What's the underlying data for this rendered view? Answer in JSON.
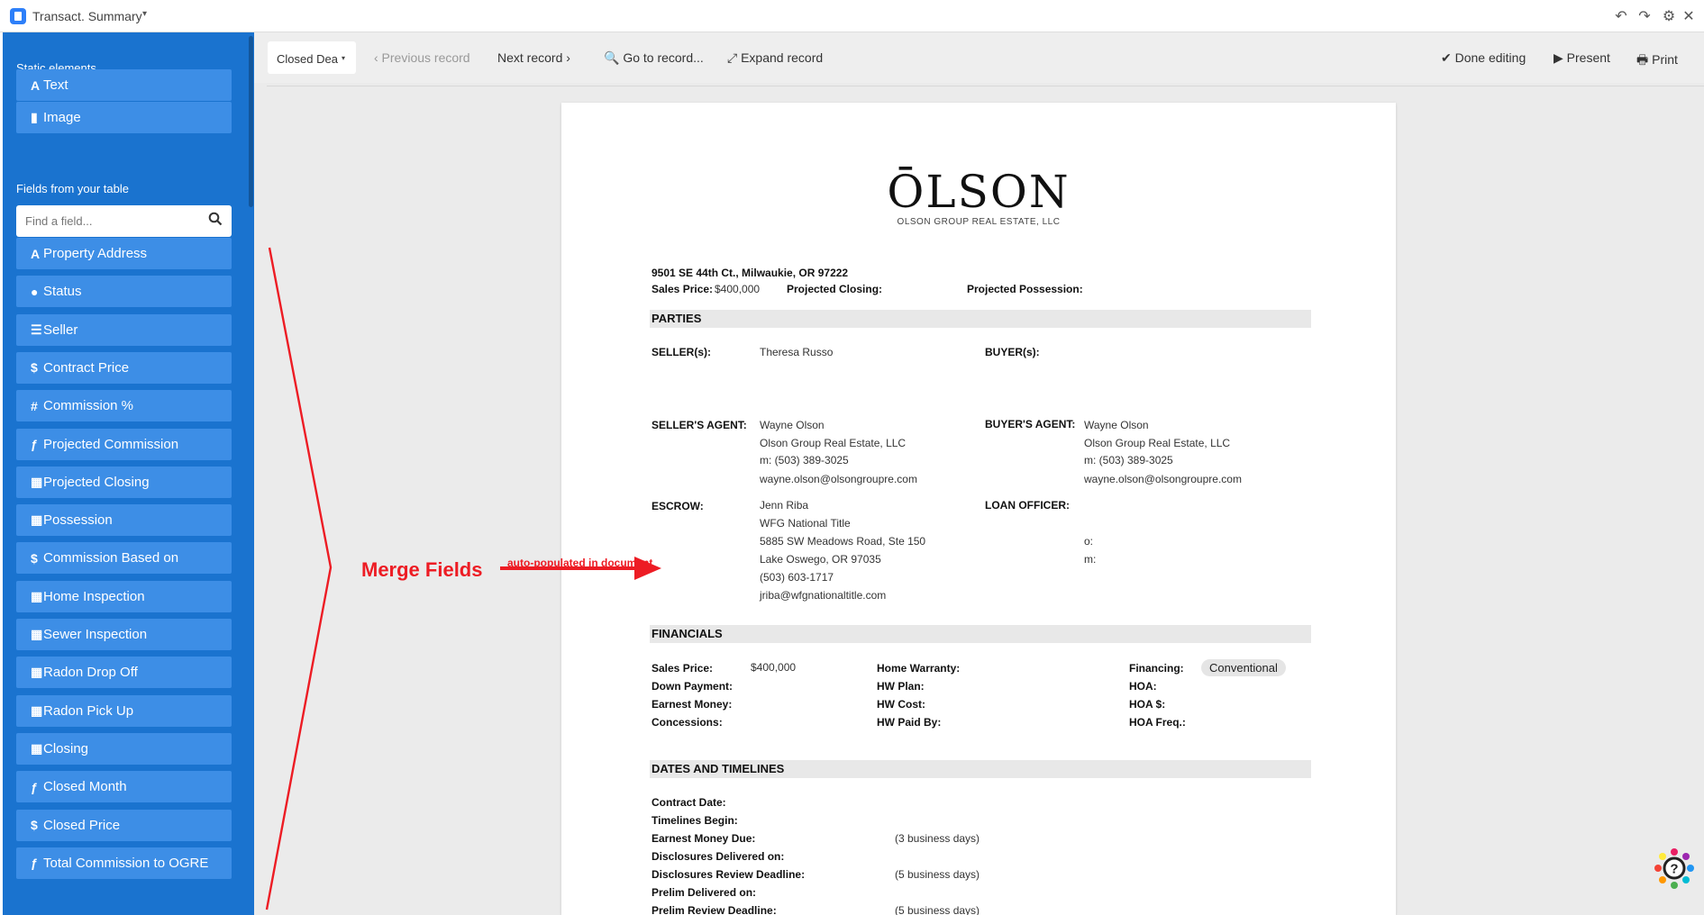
{
  "window": {
    "title": "Transact. Summary",
    "caret": "▾",
    "controls": {
      "undo": "↶",
      "redo": "↷",
      "settings": "⚙",
      "close": "✕"
    }
  },
  "sidebar": {
    "static_heading": "Static elements",
    "static_items": [
      {
        "icon": "A",
        "label": "Text"
      },
      {
        "icon": "▮",
        "label": "Image"
      }
    ],
    "fields_heading": "Fields from your table",
    "search_placeholder": "Find a field...",
    "fields": [
      {
        "icon": "A",
        "label": "Property Address"
      },
      {
        "icon": "●",
        "label": "Status"
      },
      {
        "icon": "☰",
        "label": "Seller"
      },
      {
        "icon": "$",
        "label": "Contract Price"
      },
      {
        "icon": "#",
        "label": "Commission %"
      },
      {
        "icon": "ƒ",
        "label": "Projected Commission"
      },
      {
        "icon": "▦",
        "label": "Projected Closing"
      },
      {
        "icon": "▦",
        "label": "Possession"
      },
      {
        "icon": "$",
        "label": "Commission Based on"
      },
      {
        "icon": "▦",
        "label": "Home Inspection"
      },
      {
        "icon": "▦",
        "label": "Sewer Inspection"
      },
      {
        "icon": "▦",
        "label": "Radon Drop Off"
      },
      {
        "icon": "▦",
        "label": "Radon Pick Up"
      },
      {
        "icon": "▦",
        "label": "Closing"
      },
      {
        "icon": "ƒ",
        "label": "Closed Month"
      },
      {
        "icon": "$",
        "label": "Closed Price"
      },
      {
        "icon": "ƒ",
        "label": "Total Commission to OGRE"
      }
    ]
  },
  "toolbar": {
    "view": "Closed Dea",
    "view_caret": "▾",
    "previous": "‹  Previous record",
    "next": "Next record  ›",
    "goto": "🔍 Go to record...",
    "expand": "⤢ Expand record",
    "done": "✔ Done editing",
    "present": "▶ Present",
    "print": "🖶 Print"
  },
  "document": {
    "logo": "ŌLSON",
    "logo_sub": "OLSON GROUP REAL ESTATE, LLC",
    "address": "9501 SE 44th Ct., Milwaukie, OR 97222",
    "sales_price_label": "Sales Price:",
    "sales_price": "$400,000",
    "projected_closing_label": "Projected Closing:",
    "projected_possession_label": "Projected Possession:",
    "parties_title": "PARTIES",
    "sellers_label": "SELLER(s):",
    "seller_name": "Theresa Russo",
    "buyers_label": "BUYER(s):",
    "sellers_agent_label": "SELLER'S AGENT:",
    "buyers_agent_label": "BUYER'S AGENT:",
    "agent": {
      "name": "Wayne Olson",
      "company": "Olson Group Real Estate, LLC",
      "phone": "m:  (503) 389-3025",
      "email": "wayne.olson@olsongroupre.com"
    },
    "escrow_label": "ESCROW:",
    "escrow": {
      "name": "Jenn Riba",
      "company": "WFG National Title",
      "street": "5885 SW Meadows Road, Ste 150",
      "city": "Lake Oswego, OR 97035",
      "phone": "(503) 603-1717",
      "email": "jriba@wfgnationaltitle.com"
    },
    "loan_officer_label": "LOAN OFFICER:",
    "lo_o": "o:",
    "lo_m": "m:",
    "financials_title": "FINANCIALS",
    "fin_col1": [
      "Sales Price:",
      "Down Payment:",
      "Earnest Money:",
      "Concessions:"
    ],
    "fin_sales_price": "$400,000",
    "fin_col2": [
      "Home Warranty:",
      "HW Plan:",
      "HW Cost:",
      "HW Paid By:"
    ],
    "fin_col3": [
      "Financing:",
      "HOA:",
      "HOA $:",
      "HOA Freq.:"
    ],
    "financing_value": "Conventional",
    "dates_title": "DATES AND TIMELINES",
    "dates": [
      {
        "label": "Contract Date:",
        "note": ""
      },
      {
        "label": "Timelines Begin:",
        "note": ""
      },
      {
        "label": "Earnest Money Due:",
        "note": "(3 business days)"
      },
      {
        "label": "Disclosures Delivered on:",
        "note": ""
      },
      {
        "label": "Disclosures Review Deadline:",
        "note": "(5 business days)"
      },
      {
        "label": "Prelim Delivered on:",
        "note": ""
      },
      {
        "label": "Prelim Review Deadline:",
        "note": "(5 business days)"
      }
    ]
  },
  "annotation": {
    "label": "Merge Fields",
    "sub": "auto-populated in document",
    "color": "#ed1c24"
  },
  "help_badge": "?"
}
